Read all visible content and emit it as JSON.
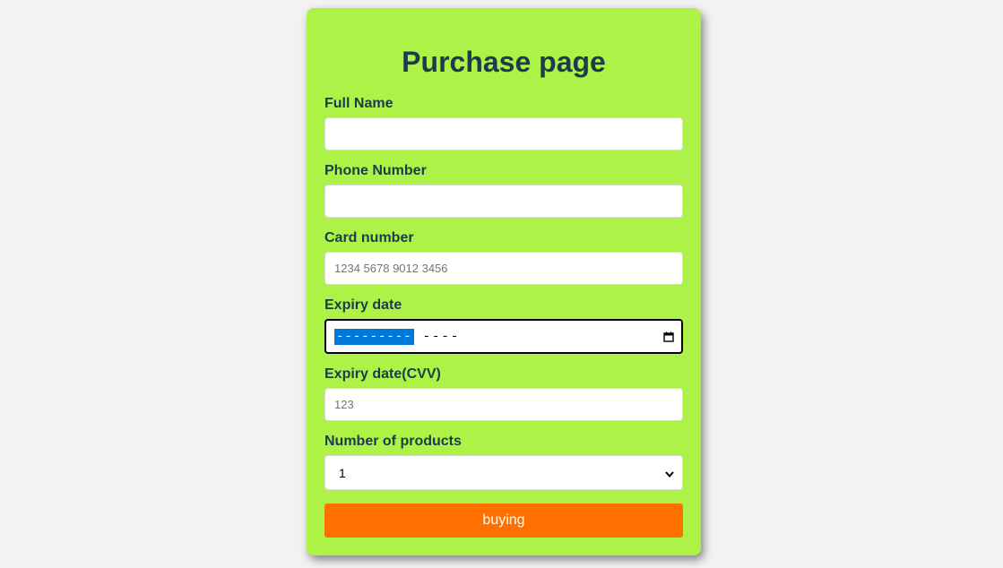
{
  "form": {
    "title": "Purchase page",
    "full_name": {
      "label": "Full Name",
      "value": "",
      "placeholder": ""
    },
    "phone": {
      "label": "Phone Number",
      "value": "",
      "placeholder": ""
    },
    "card": {
      "label": "Card number",
      "value": "",
      "placeholder": "1234 5678 9012 3456"
    },
    "expiry": {
      "label": "Expiry date",
      "selected_segment": "---------",
      "rest": "----"
    },
    "cvv": {
      "label": "Expiry date(CVV)",
      "value": "",
      "placeholder": "123"
    },
    "products": {
      "label": "Number of products",
      "selected": "1"
    },
    "submit_label": "buying"
  },
  "colors": {
    "page_bg": "#f2f2f2",
    "card_bg": "#adf246",
    "heading": "#1e3a4d",
    "button_bg": "#ff7000",
    "selection": "#0078d7"
  },
  "icons": {
    "calendar": "calendar-icon",
    "select_arrow": "chevron-down-icon"
  }
}
